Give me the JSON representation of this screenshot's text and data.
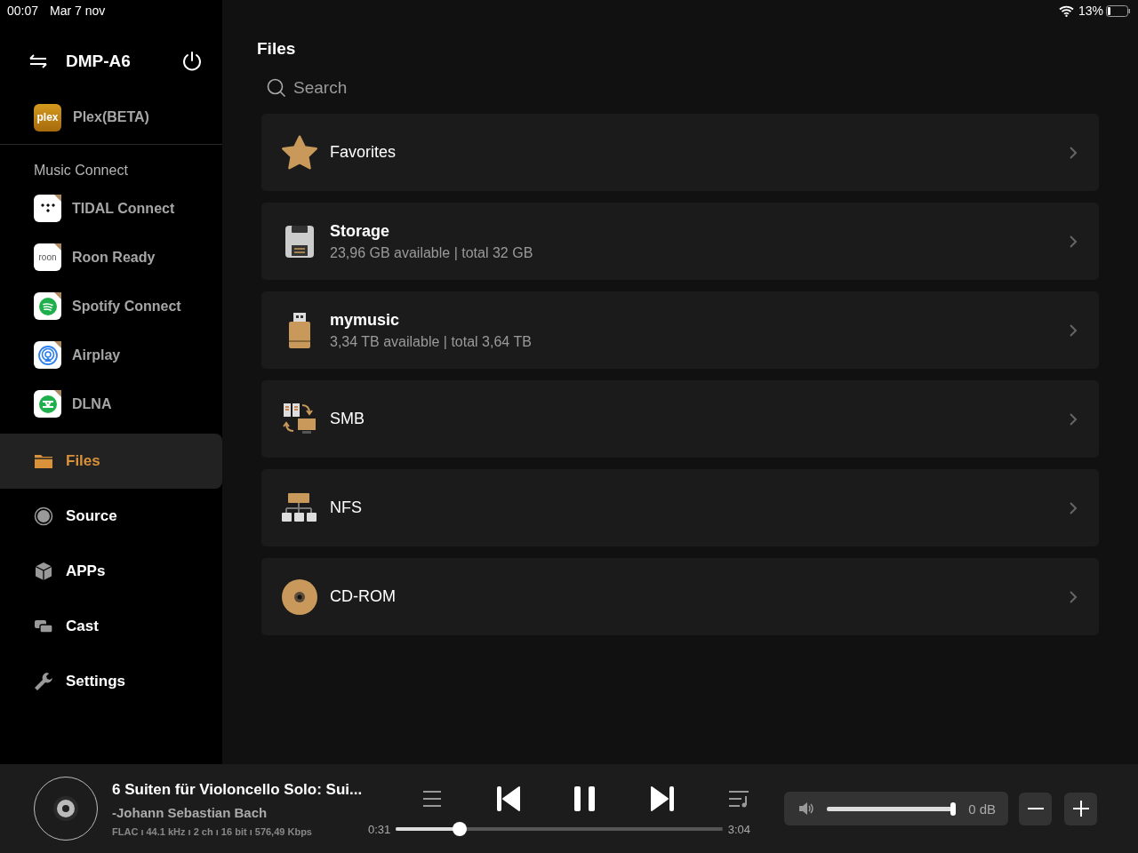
{
  "status_bar": {
    "time": "00:07",
    "date": "Mar 7 nov",
    "battery": "13%"
  },
  "sidebar": {
    "device": "DMP-A6",
    "plex_logo": "plex",
    "plex": "Plex(BETA)",
    "section_title": "Music Connect",
    "services": [
      {
        "kind": "tidal",
        "label": "TIDAL Connect"
      },
      {
        "kind": "roon",
        "label": "Roon Ready"
      },
      {
        "kind": "spotify",
        "label": "Spotify Connect"
      },
      {
        "kind": "airplay",
        "label": "Airplay"
      },
      {
        "kind": "dlna",
        "label": "DLNA"
      }
    ],
    "nav": [
      {
        "kind": "files",
        "label": "Files",
        "selected": true
      },
      {
        "kind": "source",
        "label": "Source",
        "selected": false
      },
      {
        "kind": "apps",
        "label": "APPs",
        "selected": false
      },
      {
        "kind": "cast",
        "label": "Cast",
        "selected": false
      },
      {
        "kind": "settings",
        "label": "Settings",
        "selected": false
      }
    ]
  },
  "main": {
    "title": "Files",
    "search": {
      "placeholder": "Search"
    },
    "items": [
      {
        "kind": "favorites",
        "title": "Favorites"
      },
      {
        "kind": "storage",
        "title": "Storage",
        "subtitle": "23,96 GB available | total 32 GB"
      },
      {
        "kind": "usb",
        "title": "mymusic",
        "subtitle": "3,34 TB available | total 3,64 TB"
      },
      {
        "kind": "smb",
        "title": "SMB"
      },
      {
        "kind": "nfs",
        "title": "NFS"
      },
      {
        "kind": "cdrom",
        "title": "CD-ROM"
      }
    ]
  },
  "player": {
    "title": "6 Suiten für Violoncello Solo: Sui...",
    "artist": "-Johann Sebastian Bach",
    "format": "FLAC ı 44.1 kHz ı 2 ch ı 16 bit ı 576,49 Kbps",
    "elapsed": "0:31",
    "duration": "3:04",
    "progress": {
      "level": 0.18
    },
    "volume": {
      "level": 1,
      "reading": "0 dB"
    }
  }
}
